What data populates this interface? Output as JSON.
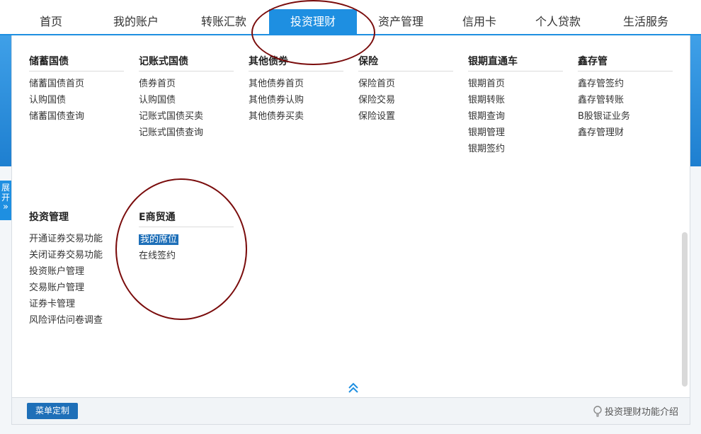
{
  "nav": {
    "items": [
      {
        "label": "首页"
      },
      {
        "label": "我的账户"
      },
      {
        "label": "转账汇款"
      },
      {
        "label": "投资理财",
        "active": true
      },
      {
        "label": "资产管理"
      },
      {
        "label": "信用卡"
      },
      {
        "label": "个人贷款"
      },
      {
        "label": "生活服务"
      }
    ]
  },
  "side": {
    "expand_label": "展开",
    "expand_glyph": "»"
  },
  "menu": {
    "columns": [
      {
        "title": "储蓄国债",
        "items": [
          "储蓄国债首页",
          "认购国债",
          "储蓄国债查询"
        ]
      },
      {
        "title": "记账式国债",
        "items": [
          "债券首页",
          "认购国债",
          "记账式国债买卖",
          "记账式国债查询"
        ]
      },
      {
        "title": "其他债券",
        "items": [
          "其他债券首页",
          "其他债券认购",
          "其他债券买卖"
        ]
      },
      {
        "title": "保险",
        "items": [
          "保险首页",
          "保险交易",
          "保险设置"
        ]
      },
      {
        "title": "银期直通车",
        "items": [
          "银期首页",
          "银期转账",
          "银期查询",
          "银期管理",
          "银期签约"
        ]
      },
      {
        "title": "鑫存管",
        "items": [
          "鑫存管签约",
          "鑫存管转账",
          "B股银证业务",
          "鑫存管理财"
        ]
      },
      {
        "title": "投资管理",
        "items": [
          "开通证券交易功能",
          "关闭证券交易功能",
          "投资账户管理",
          "交易账户管理",
          "证券卡管理",
          "风险评估问卷调查"
        ]
      },
      {
        "title": "E商贸通",
        "items": [
          "我的席位",
          "在线签约"
        ]
      }
    ]
  },
  "footer": {
    "menu_button": "菜单定制",
    "intro_label": "投资理财功能介绍"
  },
  "colors": {
    "accent": "#1e8fe1",
    "selected": "#1e6fb8",
    "annotation": "#7a0c0c"
  }
}
